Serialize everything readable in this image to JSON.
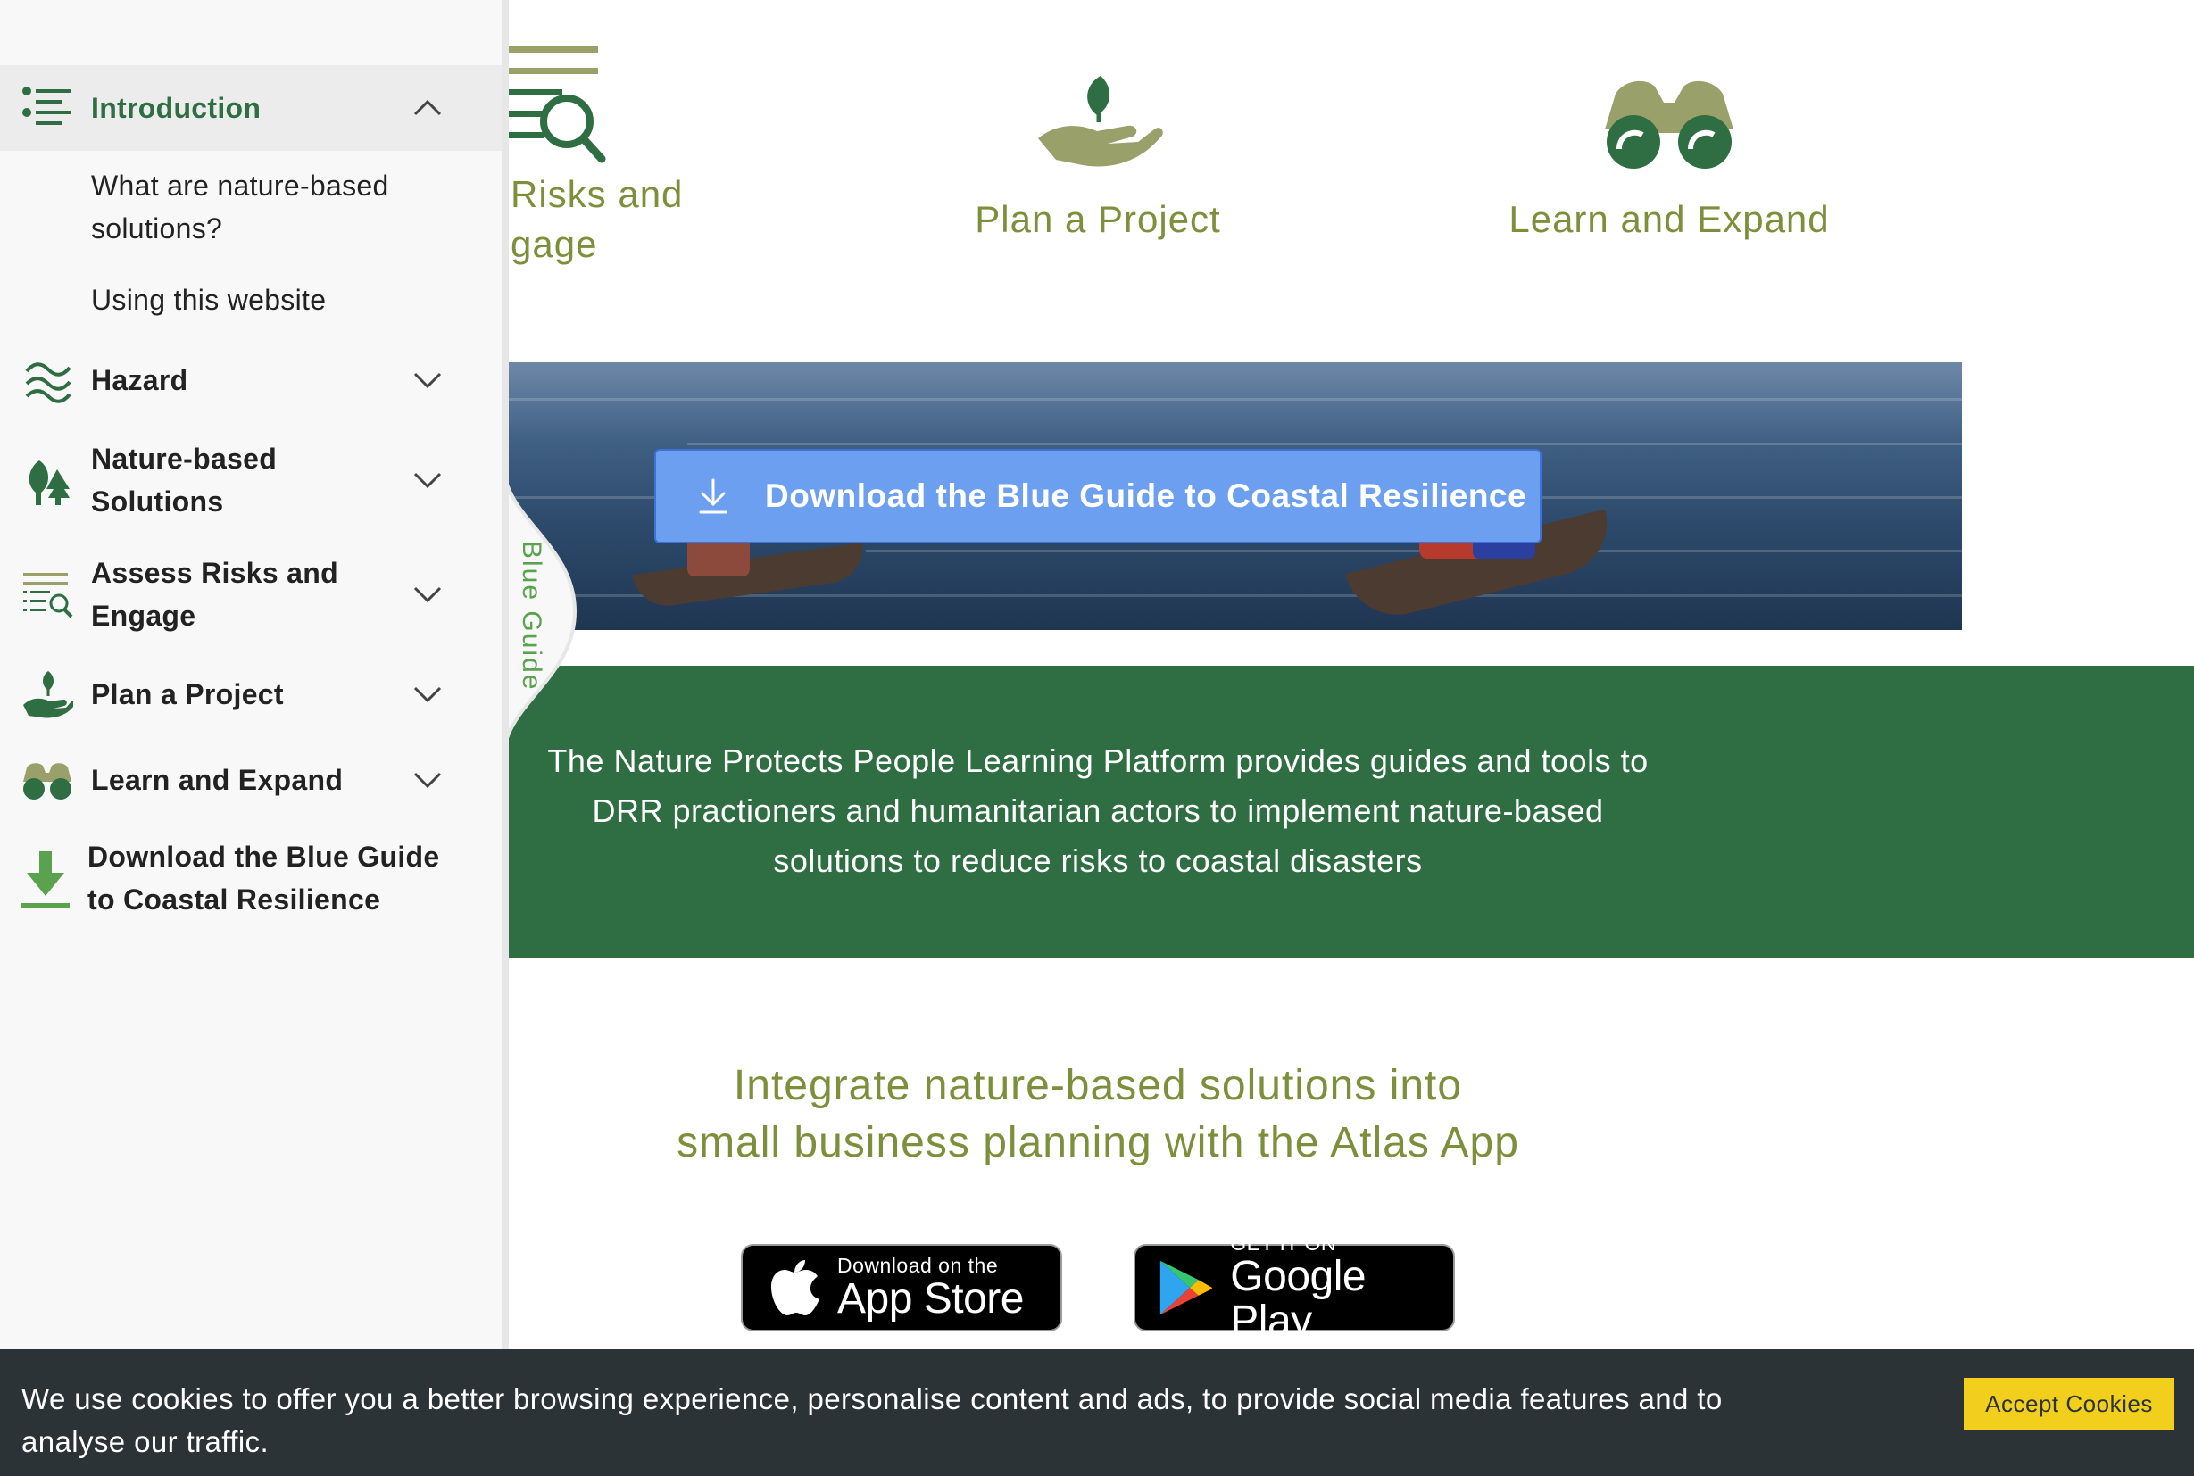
{
  "features": {
    "assess_label_lines": [
      "Risks and",
      "gage"
    ],
    "plan_label": "Plan a Project",
    "learn_label": "Learn and Expand"
  },
  "hero": {
    "download_button_label": "Download the Blue Guide to Coastal Resilience"
  },
  "mission": {
    "lines": [
      "The Nature Protects People Learning Platform provides guides and tools to",
      "DRR practioners and humanitarian actors to implement nature-based",
      "solutions to reduce risks to coastal disasters"
    ]
  },
  "atlas": {
    "heading_lines": [
      "Integrate nature-based solutions into",
      "small business planning with the Atlas App"
    ]
  },
  "stores": {
    "app_store_small": "Download on the",
    "app_store_big": "App Store",
    "google_play_small": "GET IT ON",
    "google_play_big": "Google Play"
  },
  "sidebar": {
    "blue_guide_tab": "Blue Guide",
    "items": [
      {
        "label": "Introduction",
        "icon": "list-icon",
        "expanded": true
      },
      {
        "label": "Hazard",
        "icon": "waves-icon",
        "expanded": false
      },
      {
        "label_lines": [
          "Nature-based",
          "Solutions"
        ],
        "icon": "trees-icon",
        "expanded": false
      },
      {
        "label_lines": [
          "Assess Risks and",
          "Engage"
        ],
        "icon": "list-search-icon",
        "expanded": false
      },
      {
        "label": "Plan a Project",
        "icon": "hand-plant-icon",
        "expanded": false
      },
      {
        "label": "Learn and Expand",
        "icon": "binoculars-icon",
        "expanded": false
      },
      {
        "label_lines": [
          "Download the Blue Guide",
          "to Coastal Resilience"
        ],
        "icon": "download-arrow-icon"
      }
    ],
    "intro_subitems": [
      {
        "label_lines": [
          "What are nature-based",
          "solutions?"
        ]
      },
      {
        "label": "Using this website"
      }
    ]
  },
  "cookies": {
    "text_lines": [
      "We use cookies to offer you a better browsing experience, personalise content and ads, to provide social media features and to",
      "analyse our traffic."
    ],
    "accept_label": "Accept Cookies"
  },
  "colors": {
    "brand_green": "#2f6e42",
    "olive": "#7e8f3c",
    "button_blue": "#6d9ff0",
    "cookie_bg": "#2c3336",
    "accept_yellow": "#f2cf1d"
  }
}
